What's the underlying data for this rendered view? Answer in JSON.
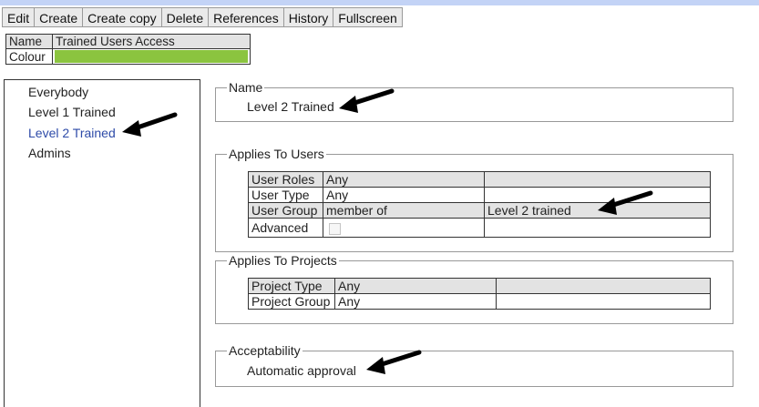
{
  "toolbar": {
    "edit": "Edit",
    "create": "Create",
    "create_copy": "Create copy",
    "delete": "Delete",
    "references": "References",
    "history": "History",
    "fullscreen": "Fullscreen"
  },
  "header": {
    "name_label": "Name",
    "name_value": "Trained Users Access",
    "colour_label": "Colour",
    "colour_value": "#8bc43f"
  },
  "groups": [
    {
      "label": "Everybody"
    },
    {
      "label": "Level 1 Trained"
    },
    {
      "label": "Level 2 Trained",
      "selected": true
    },
    {
      "label": "Admins"
    }
  ],
  "name_section": {
    "legend": "Name",
    "value": "Level 2 Trained"
  },
  "applies_to_users": {
    "legend": "Applies To Users",
    "rows": [
      {
        "label": "User Roles",
        "value": "Any",
        "extra": ""
      },
      {
        "label": "User Type",
        "value": "Any",
        "extra": ""
      },
      {
        "label": "User Group",
        "value": "member of",
        "extra": "Level 2 trained"
      },
      {
        "label": "Advanced",
        "value": "",
        "extra": ""
      }
    ]
  },
  "applies_to_projects": {
    "legend": "Applies To Projects",
    "rows": [
      {
        "label": "Project Type",
        "value": "Any",
        "extra": ""
      },
      {
        "label": "Project Group",
        "value": "Any",
        "extra": ""
      }
    ]
  },
  "acceptability": {
    "legend": "Acceptability",
    "value": "Automatic approval"
  },
  "colors": {
    "accent_selected": "#2e4ba8",
    "header_row": "#e3e3e3",
    "top_strip": "#c3d3f6"
  }
}
